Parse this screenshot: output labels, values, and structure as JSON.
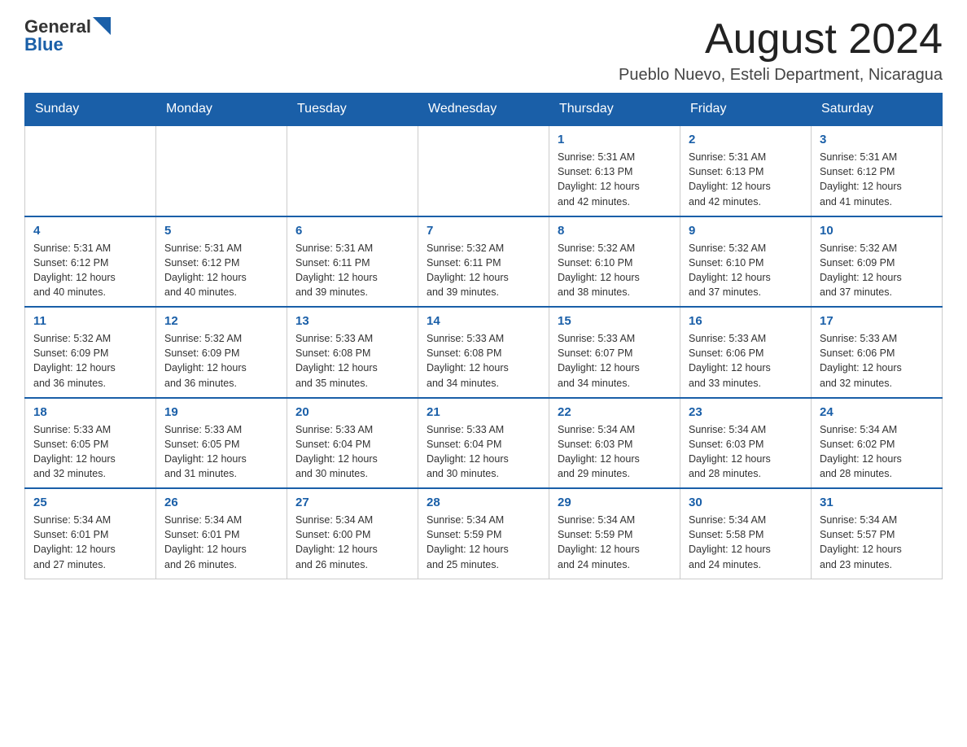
{
  "header": {
    "logo": {
      "general": "General",
      "blue": "Blue"
    },
    "title": "August 2024",
    "subtitle": "Pueblo Nuevo, Esteli Department, Nicaragua"
  },
  "days_of_week": [
    "Sunday",
    "Monday",
    "Tuesday",
    "Wednesday",
    "Thursday",
    "Friday",
    "Saturday"
  ],
  "weeks": [
    [
      {
        "day": "",
        "info": ""
      },
      {
        "day": "",
        "info": ""
      },
      {
        "day": "",
        "info": ""
      },
      {
        "day": "",
        "info": ""
      },
      {
        "day": "1",
        "info": "Sunrise: 5:31 AM\nSunset: 6:13 PM\nDaylight: 12 hours\nand 42 minutes."
      },
      {
        "day": "2",
        "info": "Sunrise: 5:31 AM\nSunset: 6:13 PM\nDaylight: 12 hours\nand 42 minutes."
      },
      {
        "day": "3",
        "info": "Sunrise: 5:31 AM\nSunset: 6:12 PM\nDaylight: 12 hours\nand 41 minutes."
      }
    ],
    [
      {
        "day": "4",
        "info": "Sunrise: 5:31 AM\nSunset: 6:12 PM\nDaylight: 12 hours\nand 40 minutes."
      },
      {
        "day": "5",
        "info": "Sunrise: 5:31 AM\nSunset: 6:12 PM\nDaylight: 12 hours\nand 40 minutes."
      },
      {
        "day": "6",
        "info": "Sunrise: 5:31 AM\nSunset: 6:11 PM\nDaylight: 12 hours\nand 39 minutes."
      },
      {
        "day": "7",
        "info": "Sunrise: 5:32 AM\nSunset: 6:11 PM\nDaylight: 12 hours\nand 39 minutes."
      },
      {
        "day": "8",
        "info": "Sunrise: 5:32 AM\nSunset: 6:10 PM\nDaylight: 12 hours\nand 38 minutes."
      },
      {
        "day": "9",
        "info": "Sunrise: 5:32 AM\nSunset: 6:10 PM\nDaylight: 12 hours\nand 37 minutes."
      },
      {
        "day": "10",
        "info": "Sunrise: 5:32 AM\nSunset: 6:09 PM\nDaylight: 12 hours\nand 37 minutes."
      }
    ],
    [
      {
        "day": "11",
        "info": "Sunrise: 5:32 AM\nSunset: 6:09 PM\nDaylight: 12 hours\nand 36 minutes."
      },
      {
        "day": "12",
        "info": "Sunrise: 5:32 AM\nSunset: 6:09 PM\nDaylight: 12 hours\nand 36 minutes."
      },
      {
        "day": "13",
        "info": "Sunrise: 5:33 AM\nSunset: 6:08 PM\nDaylight: 12 hours\nand 35 minutes."
      },
      {
        "day": "14",
        "info": "Sunrise: 5:33 AM\nSunset: 6:08 PM\nDaylight: 12 hours\nand 34 minutes."
      },
      {
        "day": "15",
        "info": "Sunrise: 5:33 AM\nSunset: 6:07 PM\nDaylight: 12 hours\nand 34 minutes."
      },
      {
        "day": "16",
        "info": "Sunrise: 5:33 AM\nSunset: 6:06 PM\nDaylight: 12 hours\nand 33 minutes."
      },
      {
        "day": "17",
        "info": "Sunrise: 5:33 AM\nSunset: 6:06 PM\nDaylight: 12 hours\nand 32 minutes."
      }
    ],
    [
      {
        "day": "18",
        "info": "Sunrise: 5:33 AM\nSunset: 6:05 PM\nDaylight: 12 hours\nand 32 minutes."
      },
      {
        "day": "19",
        "info": "Sunrise: 5:33 AM\nSunset: 6:05 PM\nDaylight: 12 hours\nand 31 minutes."
      },
      {
        "day": "20",
        "info": "Sunrise: 5:33 AM\nSunset: 6:04 PM\nDaylight: 12 hours\nand 30 minutes."
      },
      {
        "day": "21",
        "info": "Sunrise: 5:33 AM\nSunset: 6:04 PM\nDaylight: 12 hours\nand 30 minutes."
      },
      {
        "day": "22",
        "info": "Sunrise: 5:34 AM\nSunset: 6:03 PM\nDaylight: 12 hours\nand 29 minutes."
      },
      {
        "day": "23",
        "info": "Sunrise: 5:34 AM\nSunset: 6:03 PM\nDaylight: 12 hours\nand 28 minutes."
      },
      {
        "day": "24",
        "info": "Sunrise: 5:34 AM\nSunset: 6:02 PM\nDaylight: 12 hours\nand 28 minutes."
      }
    ],
    [
      {
        "day": "25",
        "info": "Sunrise: 5:34 AM\nSunset: 6:01 PM\nDaylight: 12 hours\nand 27 minutes."
      },
      {
        "day": "26",
        "info": "Sunrise: 5:34 AM\nSunset: 6:01 PM\nDaylight: 12 hours\nand 26 minutes."
      },
      {
        "day": "27",
        "info": "Sunrise: 5:34 AM\nSunset: 6:00 PM\nDaylight: 12 hours\nand 26 minutes."
      },
      {
        "day": "28",
        "info": "Sunrise: 5:34 AM\nSunset: 5:59 PM\nDaylight: 12 hours\nand 25 minutes."
      },
      {
        "day": "29",
        "info": "Sunrise: 5:34 AM\nSunset: 5:59 PM\nDaylight: 12 hours\nand 24 minutes."
      },
      {
        "day": "30",
        "info": "Sunrise: 5:34 AM\nSunset: 5:58 PM\nDaylight: 12 hours\nand 24 minutes."
      },
      {
        "day": "31",
        "info": "Sunrise: 5:34 AM\nSunset: 5:57 PM\nDaylight: 12 hours\nand 23 minutes."
      }
    ]
  ]
}
